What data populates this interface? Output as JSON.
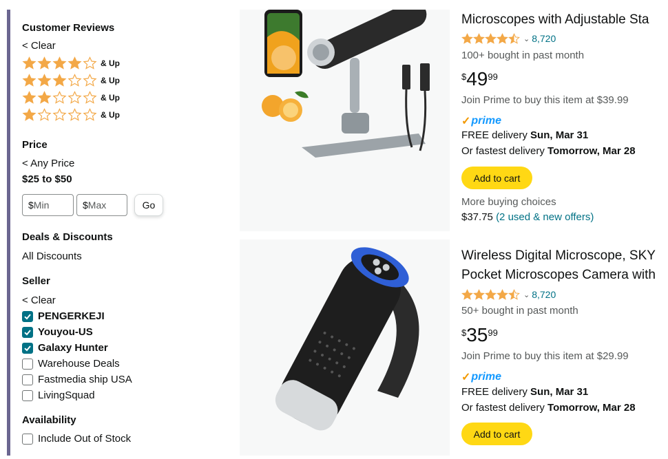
{
  "colors": {
    "accent_bar": "#6b6690",
    "star": "#f3a847",
    "link": "#007185",
    "prime_blue": "#1399ff",
    "cart_yellow": "#ffd814",
    "check_teal": "#007185"
  },
  "sidebar": {
    "reviews_heading": "Customer Reviews",
    "reviews_clear": "< Clear",
    "star_rows": [
      {
        "filled": 4,
        "label": "& Up"
      },
      {
        "filled": 3,
        "label": "& Up"
      },
      {
        "filled": 2,
        "label": "& Up"
      },
      {
        "filled": 1,
        "label": "& Up"
      }
    ],
    "price_heading": "Price",
    "any_price": "< Any Price",
    "price_range": "$25 to $50",
    "min_dollar": "$",
    "min_placeholder": "Min",
    "max_dollar": "$",
    "max_placeholder": "Max",
    "go_label": "Go",
    "deals_heading": "Deals & Discounts",
    "all_discounts": "All Discounts",
    "seller_heading": "Seller",
    "seller_clear": "< Clear",
    "sellers": [
      {
        "name": "PENGERKEJI",
        "checked": true
      },
      {
        "name": "Youyou-US",
        "checked": true
      },
      {
        "name": "Galaxy Hunter",
        "checked": true
      },
      {
        "name": "Warehouse Deals",
        "checked": false
      },
      {
        "name": "Fastmedia ship USA",
        "checked": false
      },
      {
        "name": "LivingSquad",
        "checked": false
      }
    ],
    "availability_heading": "Availability",
    "include_oos": "Include Out of Stock"
  },
  "products": [
    {
      "title": "Microscopes with Adjustable Sta",
      "rating_stars": 4.5,
      "review_count": "8,720",
      "bought": "100+ bought in past month",
      "price_symbol": "$",
      "price_whole": "49",
      "price_fraction": "99",
      "prime_offer": "Join Prime to buy this item at $39.99",
      "prime_label": "prime",
      "delivery_prefix": "FREE delivery ",
      "delivery_date": "Sun, Mar 31",
      "fast_prefix": "Or fastest delivery ",
      "fast_date": "Tomorrow, Mar 28",
      "cart_label": "Add to cart",
      "more_choices": "More buying choices",
      "used_price": "$37.75",
      "used_offers": "(2 used & new offers)"
    },
    {
      "title_line1": "Wireless Digital Microscope, SKY",
      "title_line2": "Pocket Microscopes Camera with",
      "rating_stars": 4.5,
      "review_count": "8,720",
      "bought": "50+ bought in past month",
      "price_symbol": "$",
      "price_whole": "35",
      "price_fraction": "99",
      "prime_offer": "Join Prime to buy this item at $29.99",
      "prime_label": "prime",
      "delivery_prefix": "FREE delivery ",
      "delivery_date": "Sun, Mar 31",
      "fast_prefix": "Or fastest delivery ",
      "fast_date": "Tomorrow, Mar 28",
      "cart_label": "Add to cart"
    }
  ]
}
